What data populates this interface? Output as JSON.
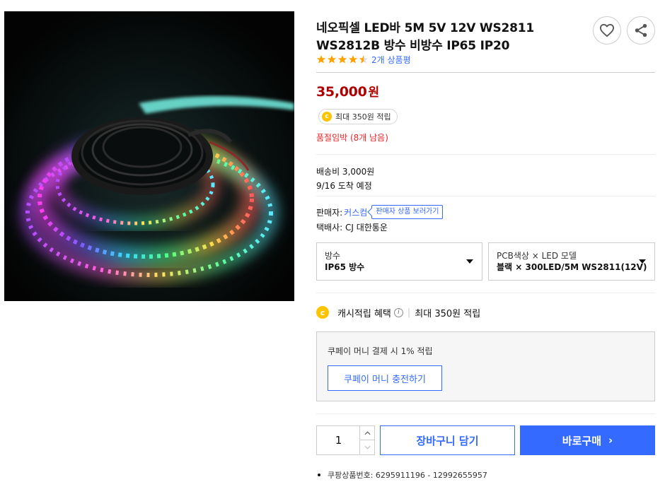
{
  "product": {
    "title": "네오픽셀 LED바 5M 5V 12V WS2811 WS2812B 방수 비방수 IP65 IP20",
    "rating": 4.5,
    "review_count_text": "2개 상품평",
    "price_value": "35,000",
    "price_unit": "원",
    "cash_badge_text": "최대 350원 적립",
    "stock_warning": "품절임박 (8개 남음)",
    "shipping_fee": "배송비 3,000원",
    "arrival": "9/16 도착 예정",
    "seller_label": "판매자:",
    "seller_name": "커스컴",
    "seller_link": "판매자 상품 보러가기",
    "courier": "택배사: CJ 대한통운",
    "product_number": "쿠팡상품번호: 6295911196 - 12992655957"
  },
  "icons": {
    "coin_letter": "c",
    "info_letter": "i",
    "buy_chevron": "›"
  },
  "options": [
    {
      "label": "방수",
      "value": "IP65 방수"
    },
    {
      "label": "PCB색상 × LED 모델",
      "value": "블랙 × 300LED/5M WS2811(12V)"
    }
  ],
  "cash_benefit": {
    "title": "캐시적립 혜택",
    "separator": "|",
    "amount": "최대 350원 적립"
  },
  "coupay": {
    "text": "쿠페이 머니 결제 시 1% 적립",
    "button_label": "쿠페이 머니 충전하기"
  },
  "purchase": {
    "quantity": "1",
    "cart_label": "장바구니 담기",
    "buy_label": "바로구매"
  },
  "colors": {
    "accent": "#346aff",
    "price": "#ae0000",
    "warning": "#e52528",
    "star": "#ffa200",
    "coin": "#ffc400"
  }
}
